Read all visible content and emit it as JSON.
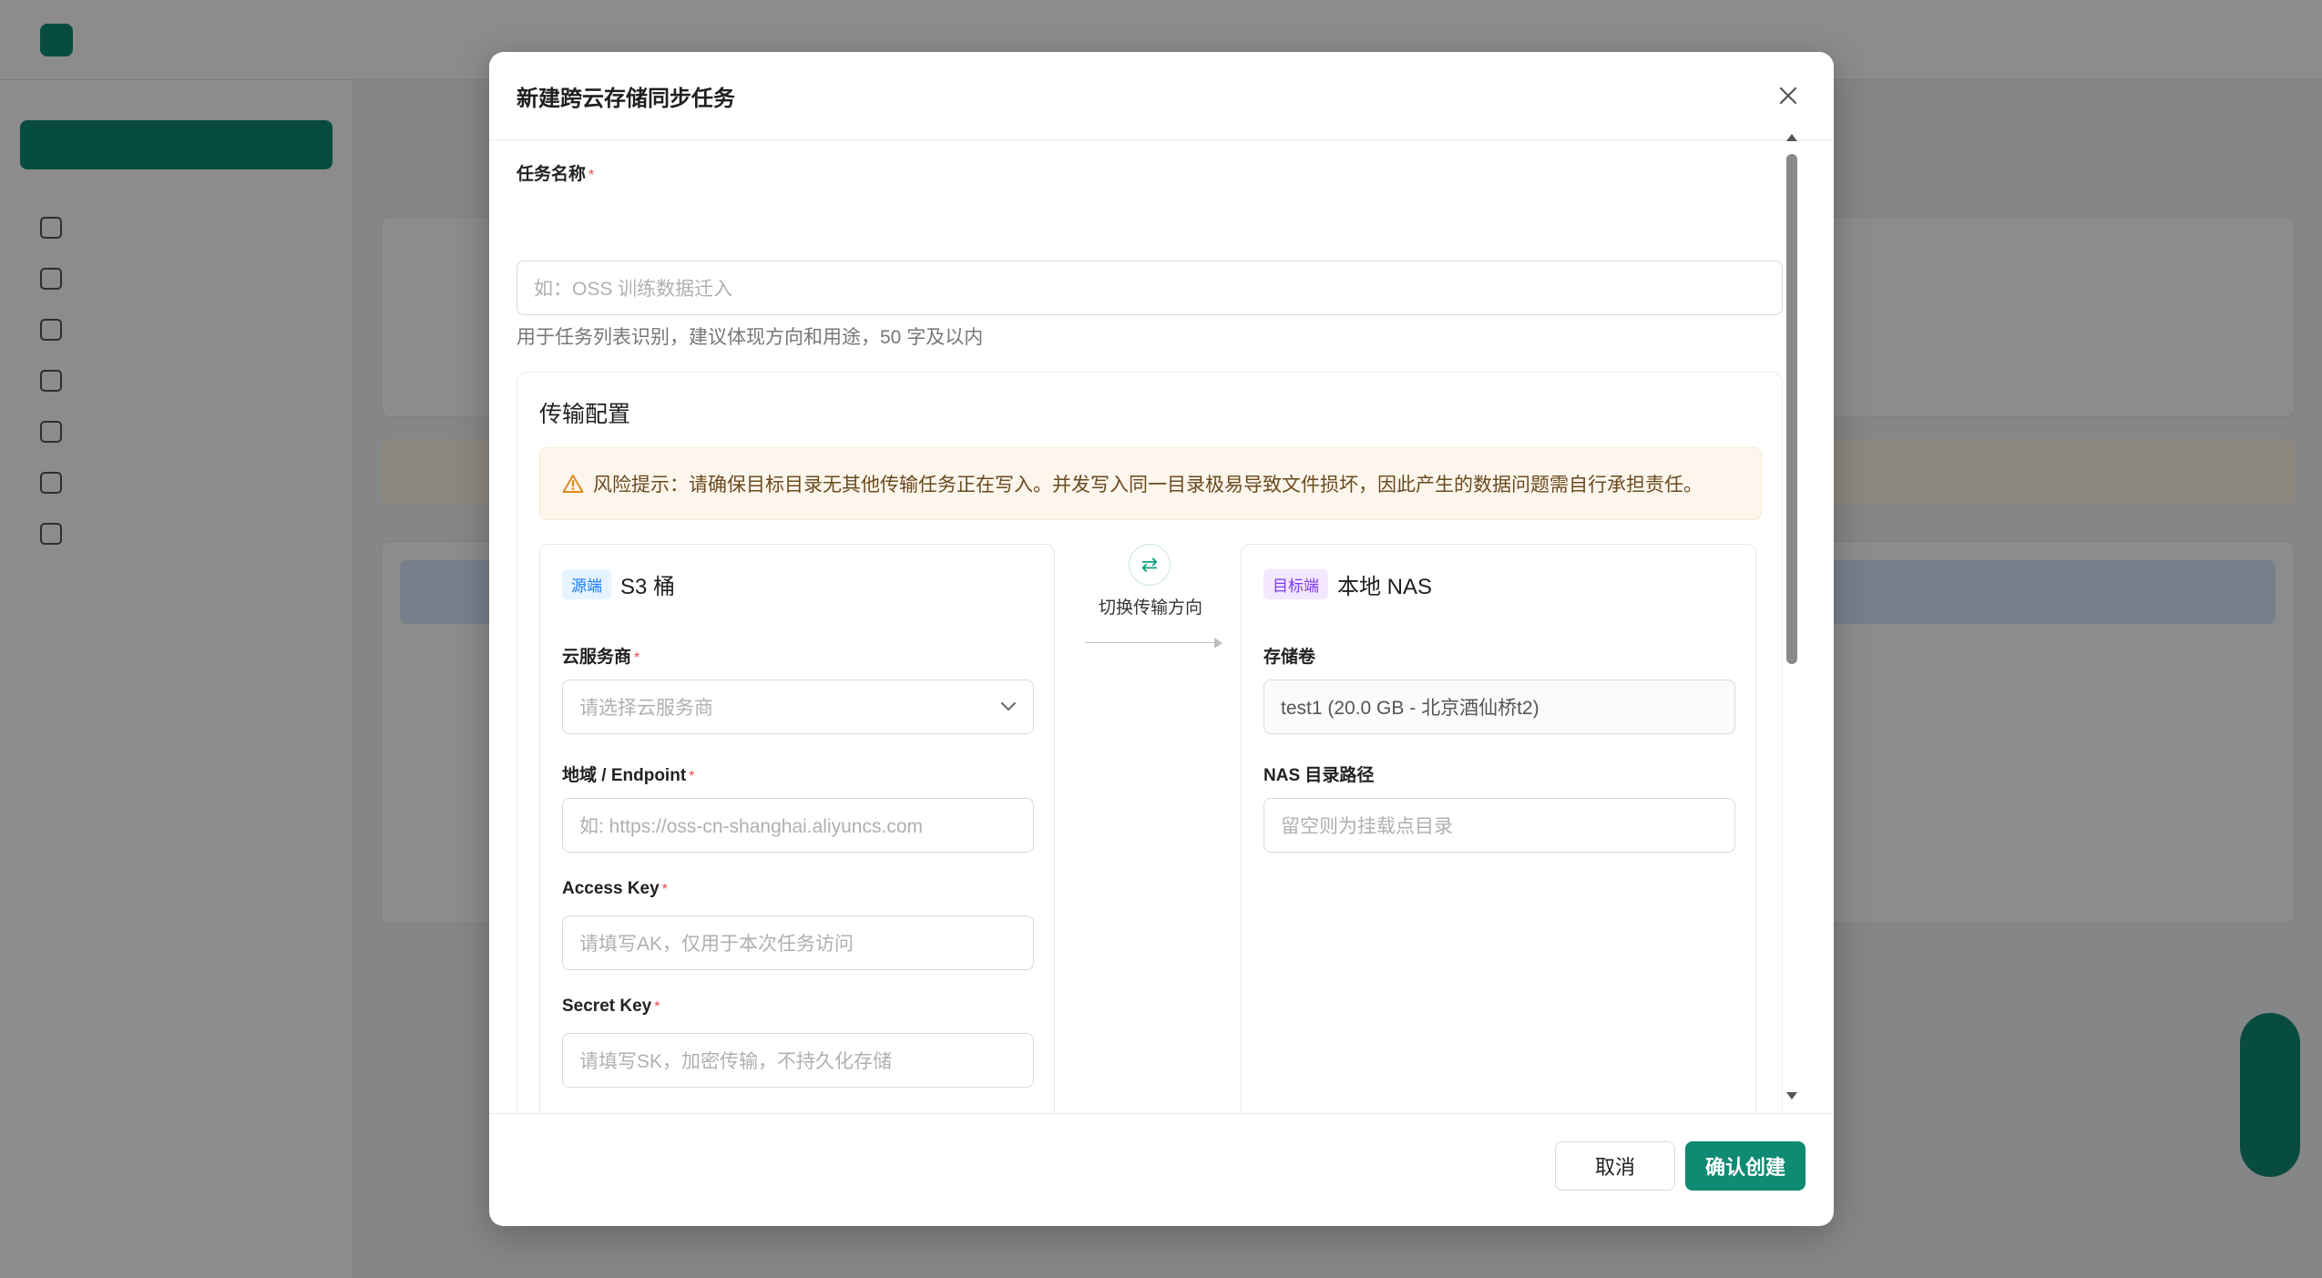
{
  "modal": {
    "title": "新建跨云存储同步任务",
    "task_name": {
      "label": "任务名称",
      "required_mark": "*",
      "placeholder": "如：OSS 训练数据迁入",
      "help": "用于任务列表识别，建议体现方向和用途，50 字及以内"
    },
    "transfer": {
      "title": "传输配置",
      "risk_notice": "风险提示：请确保目标目录无其他传输任务正在写入。并发写入同一目录极易导致文件损坏，因此产生的数据问题需自行承担责任。",
      "switch_label": "切换传输方向",
      "source": {
        "tag": "源端",
        "title": "S3 桶",
        "provider": {
          "label": "云服务商",
          "placeholder": "请选择云服务商"
        },
        "endpoint": {
          "label": "地域 / Endpoint",
          "placeholder": "如: https://oss-cn-shanghai.aliyuncs.com"
        },
        "access_key": {
          "label": "Access Key",
          "placeholder": "请填写AK，仅用于本次任务访问"
        },
        "secret_key": {
          "label": "Secret Key",
          "placeholder": "请填写SK，加密传输，不持久化存储"
        }
      },
      "target": {
        "tag": "目标端",
        "title": "本地 NAS",
        "volume": {
          "label": "存储卷",
          "value": "test1 (20.0 GB - 北京酒仙桥t2)"
        },
        "path": {
          "label": "NAS 目录路径",
          "placeholder": "留空则为挂载点目录"
        }
      }
    },
    "footer": {
      "cancel": "取消",
      "confirm": "确认创建"
    }
  },
  "colors": {
    "primary": "#0f8a73",
    "required": "#e5484d",
    "warning_bg": "#fdf6ec",
    "source_tag": "#1677ff",
    "target_tag": "#7c3aed"
  }
}
